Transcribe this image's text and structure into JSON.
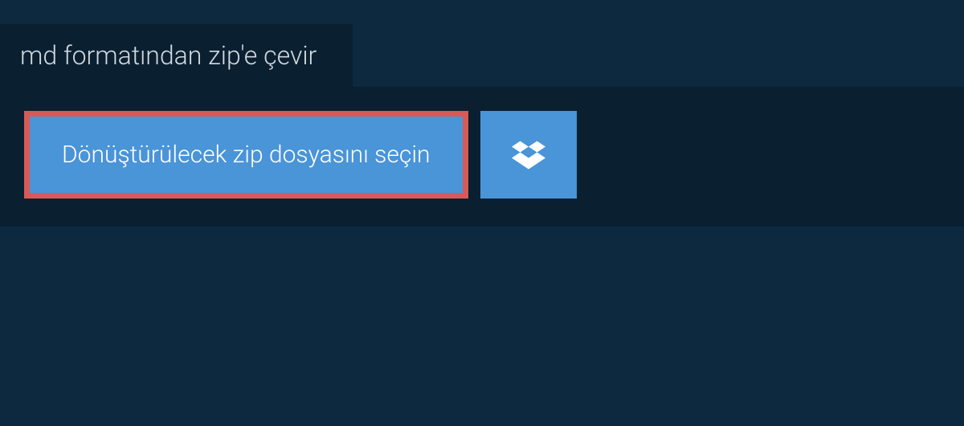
{
  "tab": {
    "label": "md formatından zip'e çevir"
  },
  "content": {
    "select_button_label": "Dönüştürülecek zip dosyasını seçin"
  },
  "colors": {
    "page_bg": "#0d2940",
    "panel_bg": "#0a1f30",
    "button_bg": "#4a94d8",
    "highlight_border": "#d85a56",
    "text_light": "#d0d8e0",
    "text_white": "#ffffff"
  }
}
